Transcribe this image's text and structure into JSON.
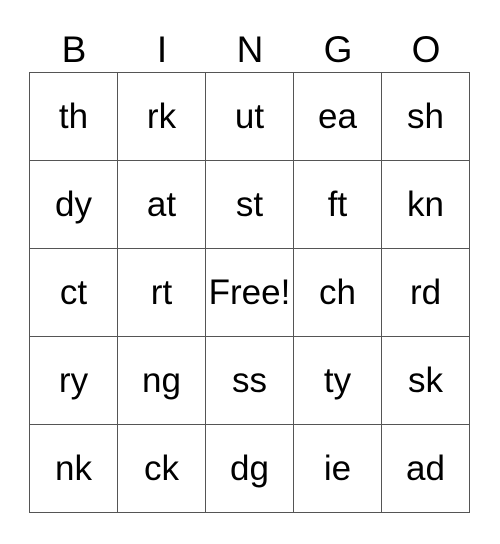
{
  "header": [
    "B",
    "I",
    "N",
    "G",
    "O"
  ],
  "rows": [
    [
      "th",
      "rk",
      "ut",
      "ea",
      "sh"
    ],
    [
      "dy",
      "at",
      "st",
      "ft",
      "kn"
    ],
    [
      "ct",
      "rt",
      "Free!",
      "ch",
      "rd"
    ],
    [
      "ry",
      "ng",
      "ss",
      "ty",
      "sk"
    ],
    [
      "nk",
      "ck",
      "dg",
      "ie",
      "ad"
    ]
  ]
}
